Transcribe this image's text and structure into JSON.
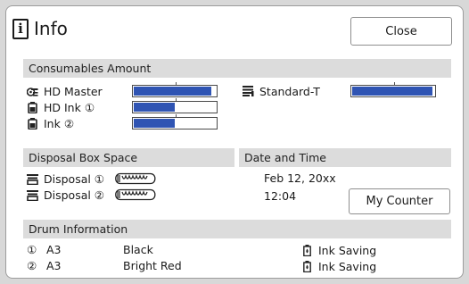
{
  "header": {
    "title": "Info",
    "close_label": "Close"
  },
  "consumables": {
    "section_label": "Consumables Amount",
    "items": [
      {
        "label": "HD Master",
        "level": 0.95
      },
      {
        "label": "HD Ink ①",
        "level": 0.5
      },
      {
        "label": "Ink ②",
        "level": 0.5
      }
    ],
    "paper": {
      "label": "Standard-T",
      "level": 0.98
    },
    "bar_color": "#2f54b3"
  },
  "disposal": {
    "section_label": "Disposal Box Space",
    "items": [
      {
        "label": "Disposal ①"
      },
      {
        "label": "Disposal ②"
      }
    ]
  },
  "datetime": {
    "section_label": "Date and Time",
    "date": "Feb 12, 20xx",
    "time": "12:04",
    "counter_label": "My Counter"
  },
  "drum": {
    "section_label": "Drum Information",
    "rows": [
      {
        "num": "①",
        "size": "A3",
        "color": "Black",
        "mode": "Ink Saving"
      },
      {
        "num": "②",
        "size": "A3",
        "color": "Bright Red",
        "mode": "Ink Saving"
      }
    ]
  },
  "icons": {
    "master": "master-roll-icon",
    "ink": "ink-cartridge-icon",
    "paper": "paper-stack-icon",
    "disposal": "disposal-box-icon",
    "gauge": "spring-gauge-icon",
    "ink_saving": "ink-saving-icon",
    "info": "info-icon"
  }
}
